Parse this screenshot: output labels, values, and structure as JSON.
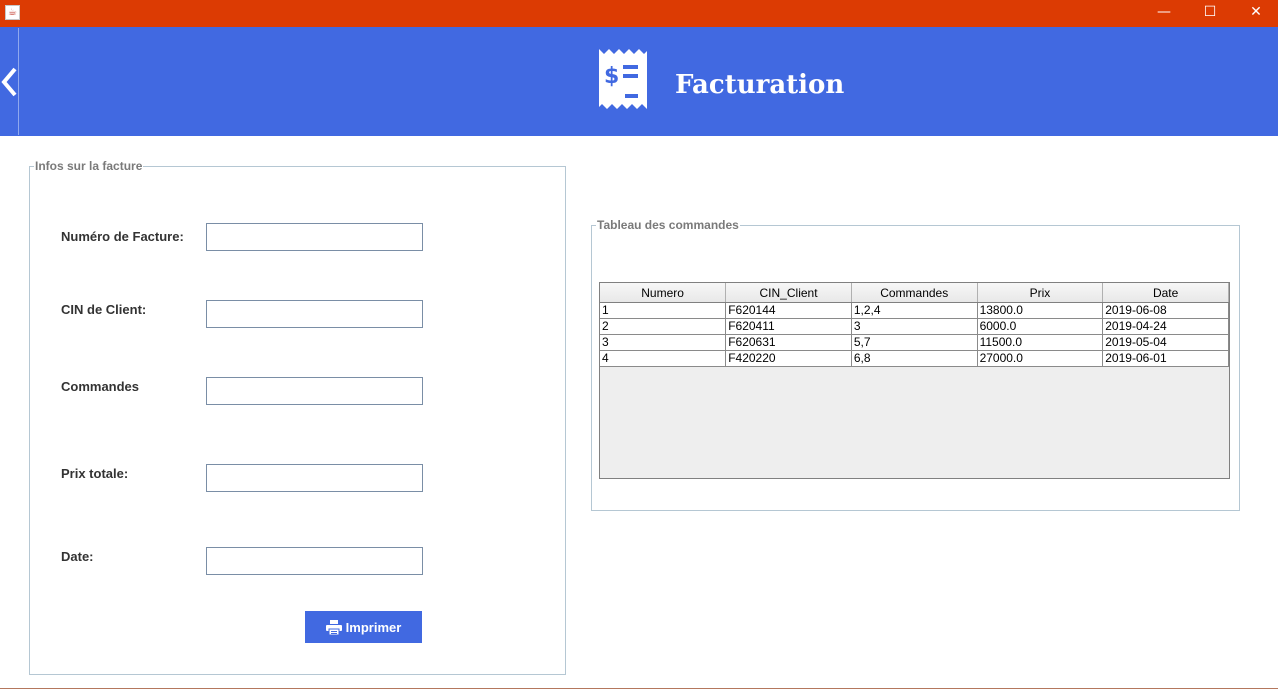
{
  "window": {
    "minimize_glyph": "—",
    "maximize_glyph": "☐",
    "close_glyph": "✕",
    "titlebar_color": "#dc3b03"
  },
  "header": {
    "title": "Facturation",
    "icon": "receipt-dollar-icon",
    "back_icon": "chevron-left-icon",
    "color": "#4169e1"
  },
  "form": {
    "legend": "Infos sur la facture",
    "fields": [
      {
        "label": "Numéro de Facture:",
        "value": ""
      },
      {
        "label": "CIN de Client:",
        "value": ""
      },
      {
        "label": "Commandes",
        "value": ""
      },
      {
        "label": "Prix totale:",
        "value": ""
      },
      {
        "label": "Date:",
        "value": ""
      }
    ],
    "print_button": "Imprimer",
    "print_icon": "printer-icon"
  },
  "orders": {
    "legend": "Tableau des commandes",
    "columns": [
      "Numero",
      "CIN_Client",
      "Commandes",
      "Prix",
      "Date"
    ],
    "rows": [
      [
        "1",
        "F620144",
        "1,2,4",
        "13800.0",
        "2019-06-08"
      ],
      [
        "2",
        "F620411",
        "3",
        "6000.0",
        "2019-04-24"
      ],
      [
        "3",
        "F620631",
        "5,7",
        "11500.0",
        "2019-05-04"
      ],
      [
        "4",
        "F420220",
        "6,8",
        "27000.0",
        "2019-06-01"
      ]
    ]
  }
}
